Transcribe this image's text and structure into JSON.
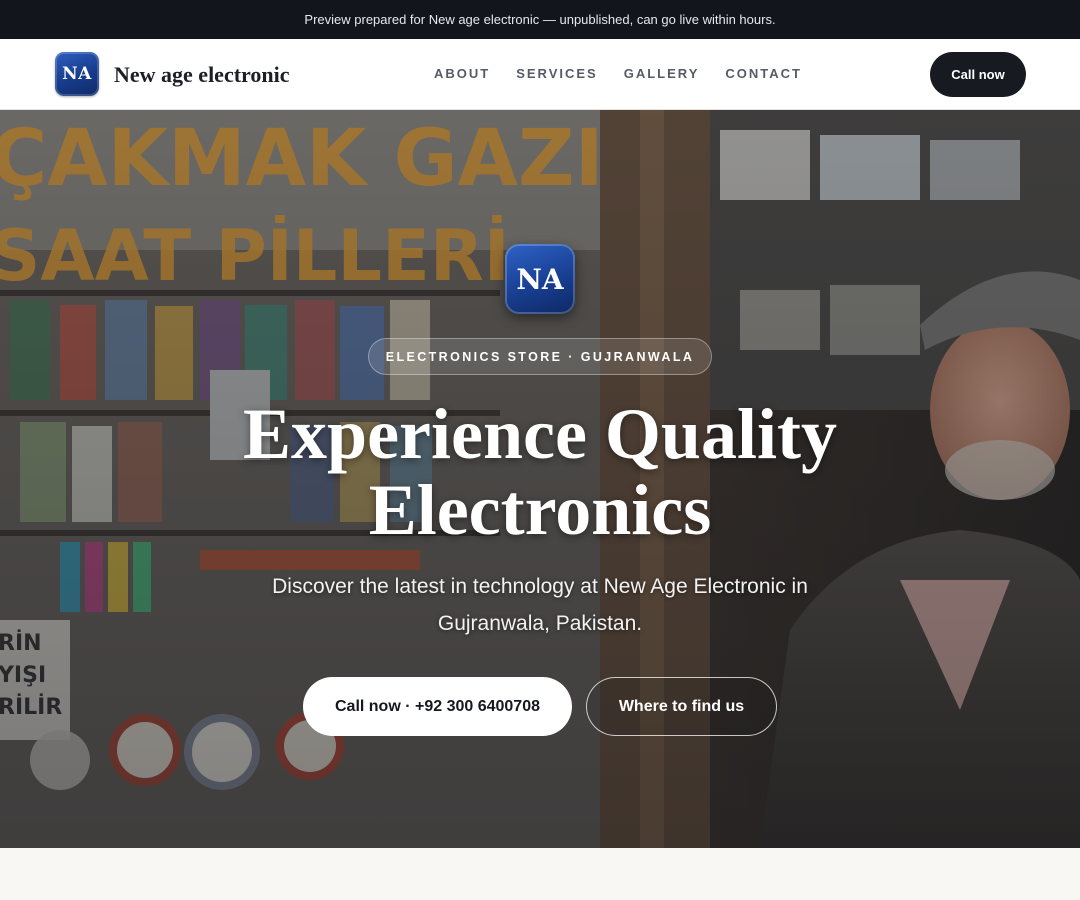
{
  "preview_bar": {
    "text": "Preview prepared for New age electronic — unpublished, can go live within hours."
  },
  "nav": {
    "logo_text": "NA",
    "brand_name": "New age electronic",
    "links": [
      "ABOUT",
      "SERVICES",
      "GALLERY",
      "CONTACT"
    ],
    "cta_label": "Call now"
  },
  "hero": {
    "logo_text": "NA",
    "badge": "ELECTRONICS STORE · GUJRANWALA",
    "title_line1": "Experience Quality",
    "title_line2": "Electronics",
    "subtitle": "Discover the latest in technology at New Age Electronic in Gujranwala, Pakistan.",
    "call_button": "Call now · +92 300 6400708",
    "find_button": "Where to find us",
    "background_scene": "electronics-shop-with-elderly-man",
    "background_sign_text_1": "ÇAKMAK GAZI",
    "background_sign_text_2": "SAAT PİLLERİ"
  },
  "colors": {
    "dark": "#171a21",
    "brand_blue": "#1a4396",
    "page_bg": "#f8f7f4"
  }
}
